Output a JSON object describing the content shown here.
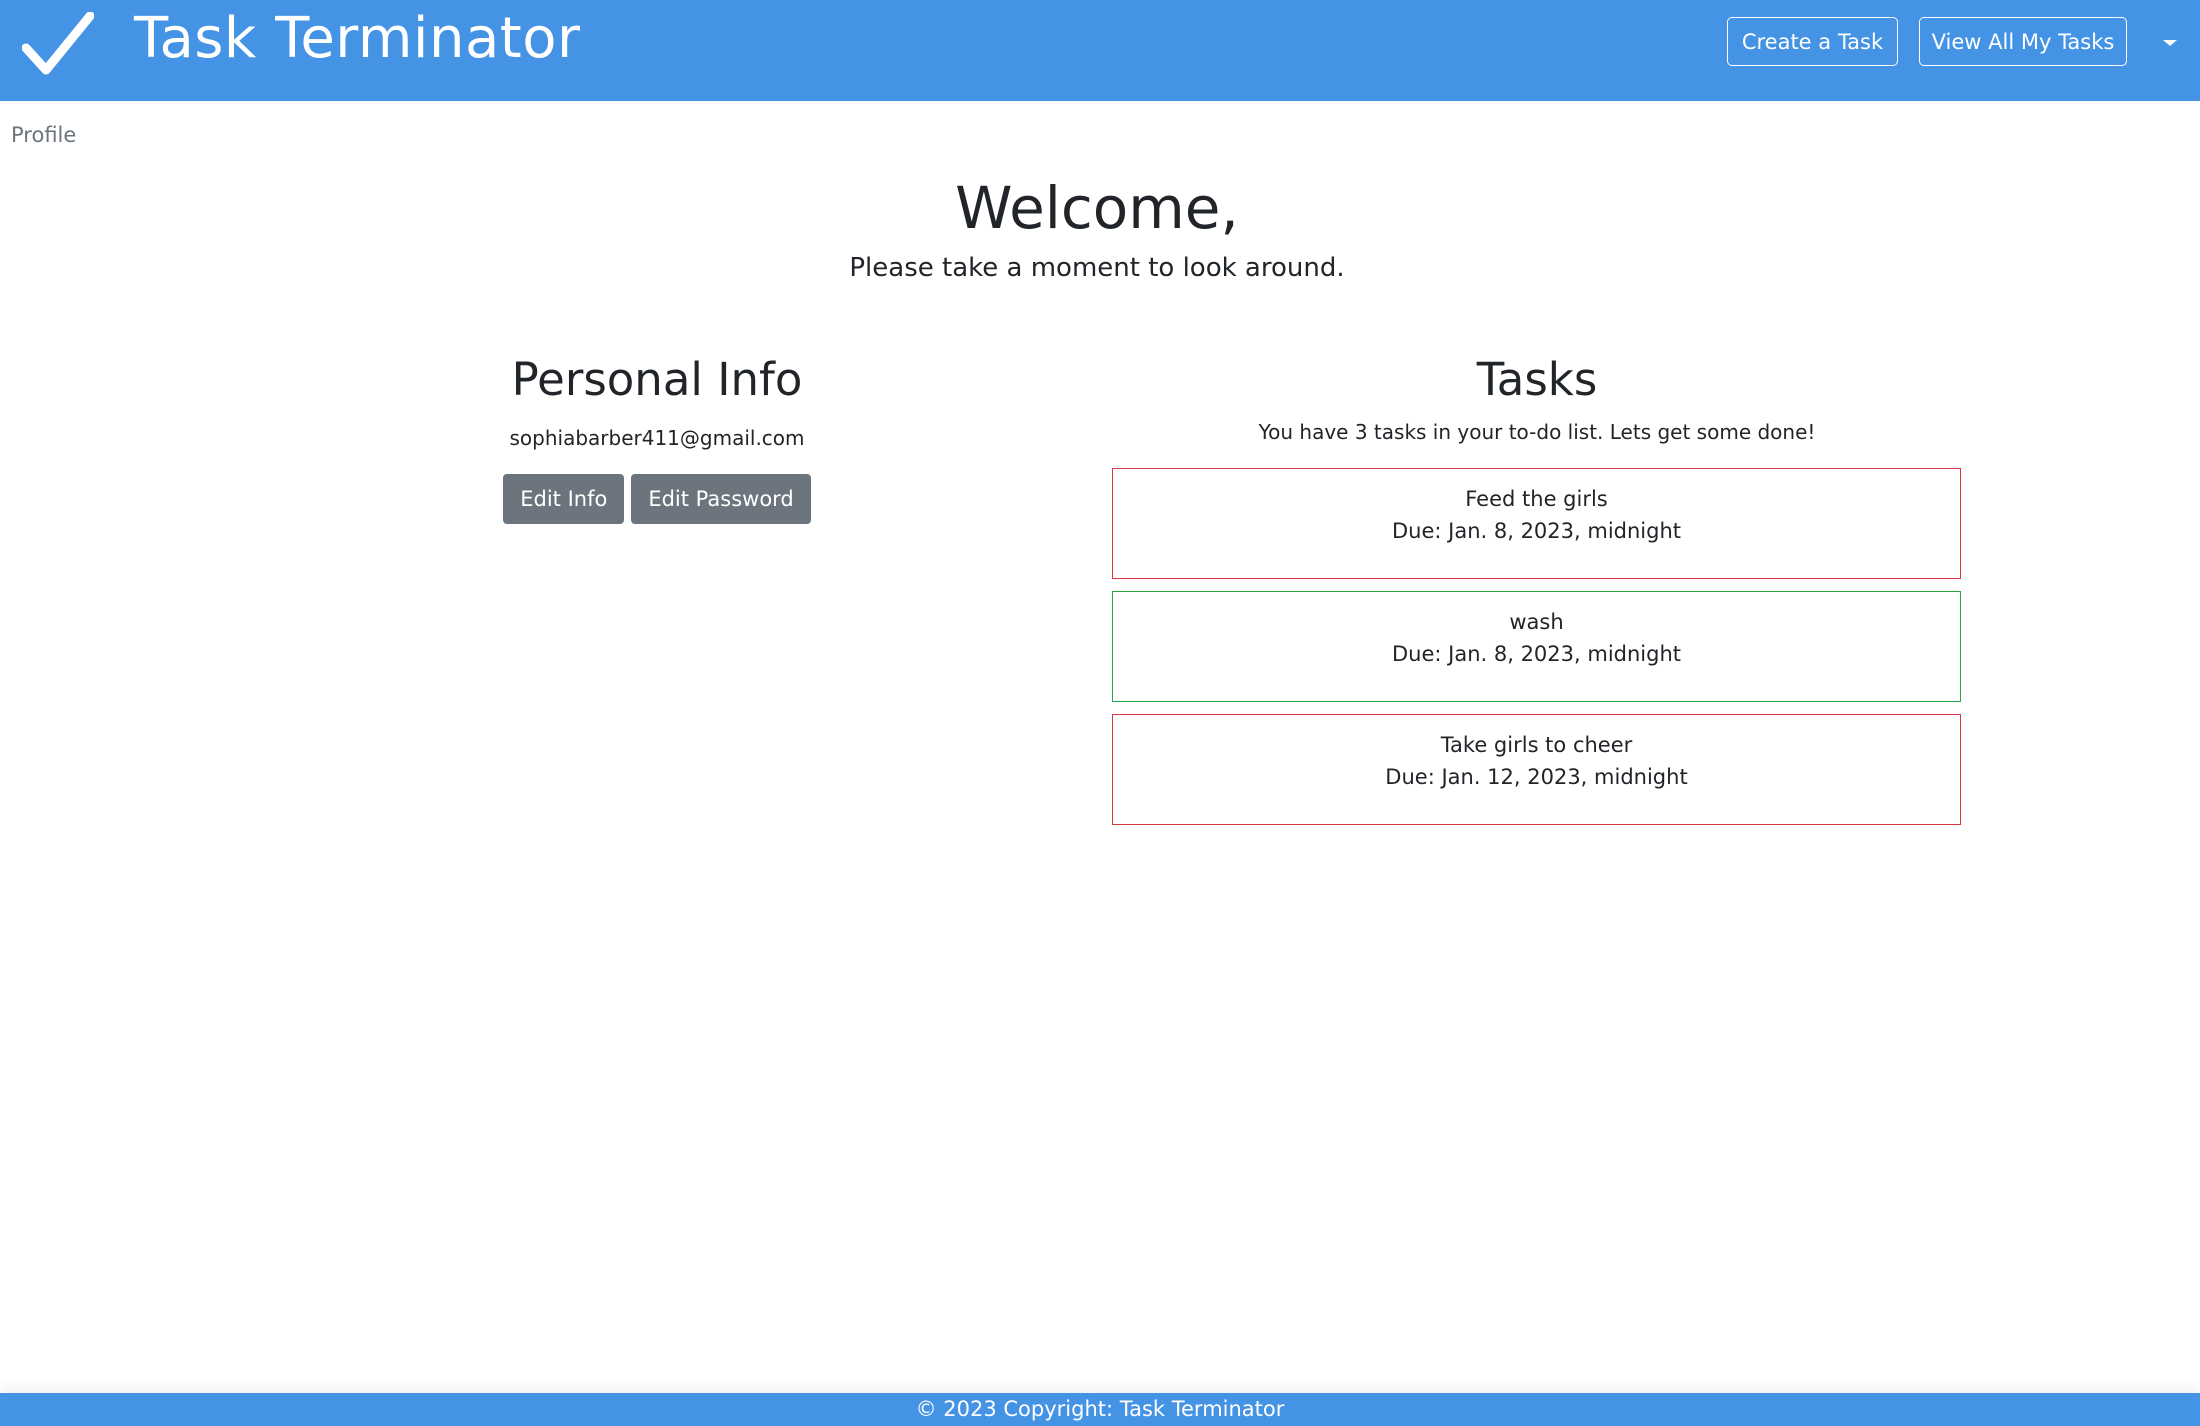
{
  "app": {
    "title": "Task Terminator",
    "accent_color": "#4493e5",
    "brand_icon": "checkmark-icon"
  },
  "nav": {
    "create_label": "Create a Task",
    "view_all_label": "View All My Tasks",
    "dropdown_icon": "caret-down-icon"
  },
  "breadcrumb": {
    "label": "Profile"
  },
  "welcome": {
    "title": "Welcome,",
    "subtitle": "Please take a moment to look around."
  },
  "personal": {
    "heading": "Personal Info",
    "email": "sophiabarber411@gmail.com",
    "edit_info_label": "Edit Info",
    "edit_password_label": "Edit Password"
  },
  "tasks": {
    "heading": "Tasks",
    "summary": "You have 3 tasks in your to-do list. Lets get some done!",
    "items": [
      {
        "name": "Feed the girls",
        "due": "Due: Jan. 8, 2023, midnight",
        "border_color": "#dc3545"
      },
      {
        "name": "wash",
        "due": "Due: Jan. 8, 2023, midnight",
        "border_color": "#28a745"
      },
      {
        "name": "Take girls to cheer",
        "due": "Due: Jan. 12, 2023, midnight",
        "border_color": "#dc3545"
      }
    ]
  },
  "footer": {
    "text": "© 2023 Copyright: Task Terminator"
  }
}
